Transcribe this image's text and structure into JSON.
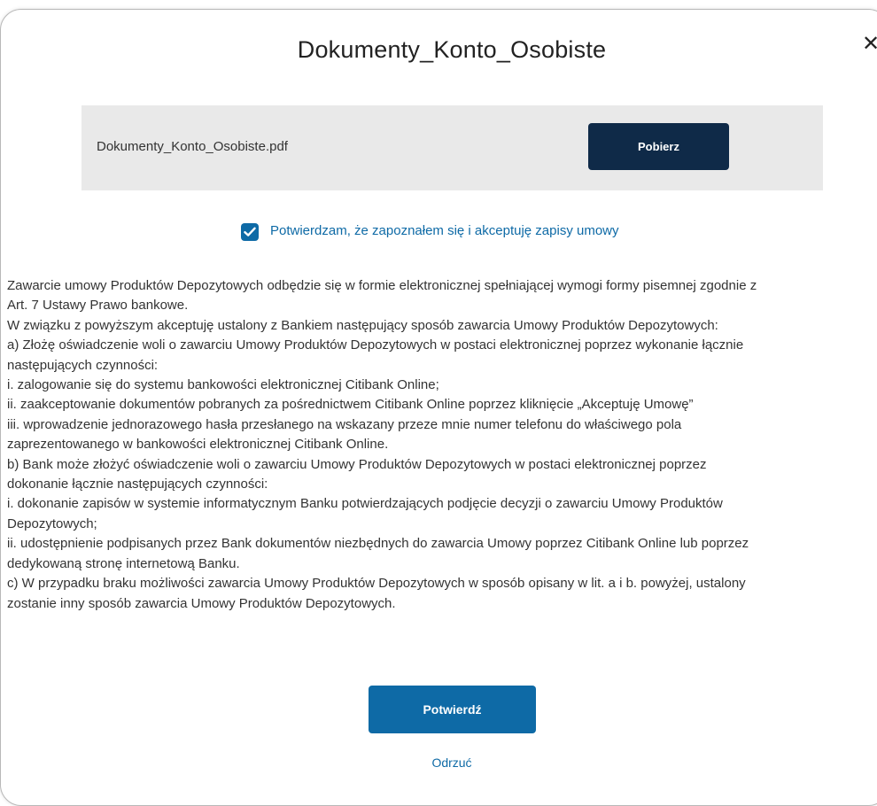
{
  "modal": {
    "title": "Dokumenty_Konto_Osobiste",
    "close_symbol": "✕"
  },
  "file": {
    "name": "Dokumenty_Konto_Osobiste.pdf",
    "download_label": "Pobierz"
  },
  "consent": {
    "checked": true,
    "label": "Potwierdzam, że zapoznałem się i akceptuję zapisy umowy"
  },
  "terms": {
    "lines": [
      "Zawarcie umowy Produktów Depozytowych odbędzie się w formie elektronicznej spełniającej wymogi formy pisemnej zgodnie z",
      "Art. 7 Ustawy Prawo bankowe.",
      "W związku z powyższym akceptuję ustalony z Bankiem następujący sposób zawarcia Umowy Produktów Depozytowych:",
      "a) Złożę oświadczenie woli o zawarciu Umowy Produktów Depozytowych w postaci elektronicznej poprzez wykonanie łącznie",
      "następujących czynności:",
      "i. zalogowanie się do systemu bankowości elektronicznej Citibank Online;",
      "ii. zaakceptowanie dokumentów pobranych za pośrednictwem Citibank Online poprzez kliknięcie „Akceptuję Umowę”",
      "iii. wprowadzenie jednorazowego hasła przesłanego na wskazany przeze mnie numer telefonu do właściwego pola",
      "zaprezentowanego w bankowości elektronicznej Citibank Online.",
      "b) Bank może złożyć oświadczenie woli o zawarciu Umowy Produktów Depozytowych w postaci elektronicznej poprzez",
      "dokonanie łącznie następujących czynności:",
      "i. dokonanie zapisów w systemie informatycznym Banku potwierdzających podjęcie decyzji o zawarciu Umowy Produktów",
      "Depozytowych;",
      "ii. udostępnienie podpisanych przez Bank dokumentów niezbędnych do zawarcia Umowy poprzez Citibank Online lub poprzez",
      "dedykowaną stronę internetową Banku.",
      "c) W przypadku braku możliwości zawarcia Umowy Produktów Depozytowych w sposób opisany w lit. a i b. powyżej, ustalony",
      "zostanie inny sposób zawarcia Umowy Produktów Depozytowych."
    ]
  },
  "actions": {
    "confirm_label": "Potwierdź",
    "reject_label": "Odrzuć"
  },
  "colors": {
    "primary": "#0e6aa6",
    "dark_button": "#0f2a48",
    "file_box_bg": "#e9e9e9"
  }
}
